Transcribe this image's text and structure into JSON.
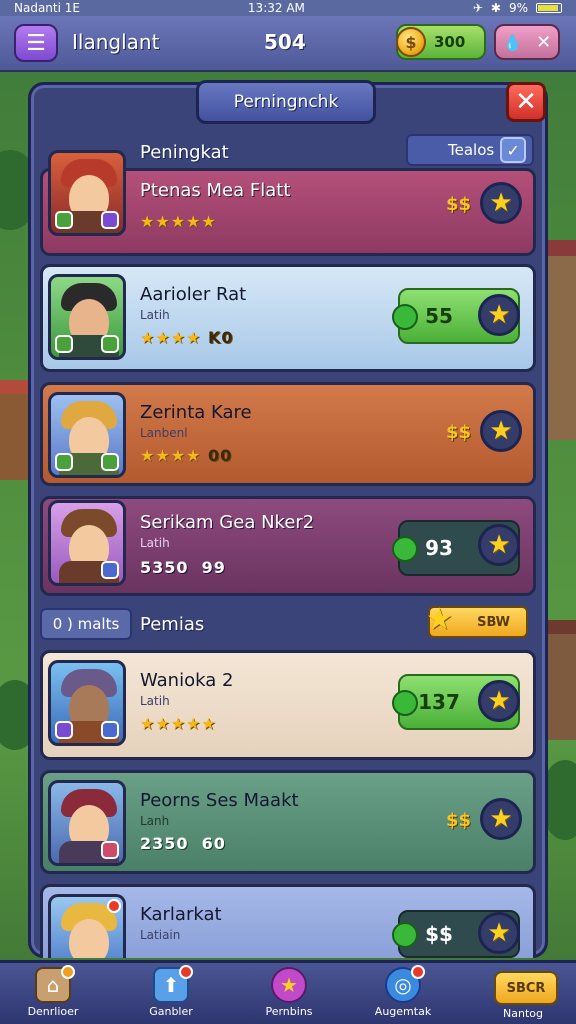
{
  "status_bar": {
    "carrier": "Nadanti 1E",
    "time": "13:32 AM",
    "battery": "9%"
  },
  "top_bar": {
    "title": "Ilanglant",
    "score": "504",
    "coins": "300"
  },
  "panel": {
    "header": "Perningnchk",
    "section_title": "Peningkat",
    "toggle_label": "Tealos"
  },
  "cards": [
    {
      "name": "Ptenas Mea Flatt",
      "sub": "",
      "stars": "★★★★★",
      "rating_extra": "",
      "price": "$$",
      "value": "",
      "pill": "none"
    },
    {
      "name": "Aarioler Rat",
      "sub": "Latih",
      "stars": "★★★★",
      "rating_extra": "K0",
      "price": "",
      "value": "55",
      "pill": "green"
    },
    {
      "name": "Zerinta Kare",
      "sub": "Lanbenl",
      "stars": "★★★★",
      "rating_extra": "00",
      "price": "$$",
      "value": "",
      "pill": "none"
    },
    {
      "name": "Serikam Gea Nker2",
      "sub": "Latih",
      "stars": "",
      "rating_extra": "5350  99",
      "price": "",
      "value": "93",
      "pill": "dark"
    },
    {
      "name": "Wanioka 2",
      "sub": "Latih",
      "stars": "★★★★★",
      "rating_extra": "",
      "price": "",
      "value": "137",
      "pill": "green"
    },
    {
      "name": "Peorns Ses Maakt",
      "sub": "Lanh",
      "stars": "",
      "rating_extra": "2350  60",
      "price": "$$",
      "value": "",
      "pill": "none"
    },
    {
      "name": "Karlarkat",
      "sub": "Latiain",
      "stars": "",
      "rating_extra": "",
      "price": "",
      "value": "$$",
      "pill": "dark"
    }
  ],
  "divider": {
    "left_button": "0 ) malts",
    "label": "Pemias",
    "right_button": "SBW"
  },
  "bottom_nav": [
    {
      "label": "Denrlioer"
    },
    {
      "label": "Ganbler"
    },
    {
      "label": "Pernbins"
    },
    {
      "label": "Augemtak"
    },
    {
      "label": "Nantog",
      "button": "SBCR"
    }
  ],
  "colors": {
    "panel": "#3a4478",
    "accent_gold": "#f8c420",
    "green": "#4ab038",
    "close_red": "#d0302a"
  }
}
